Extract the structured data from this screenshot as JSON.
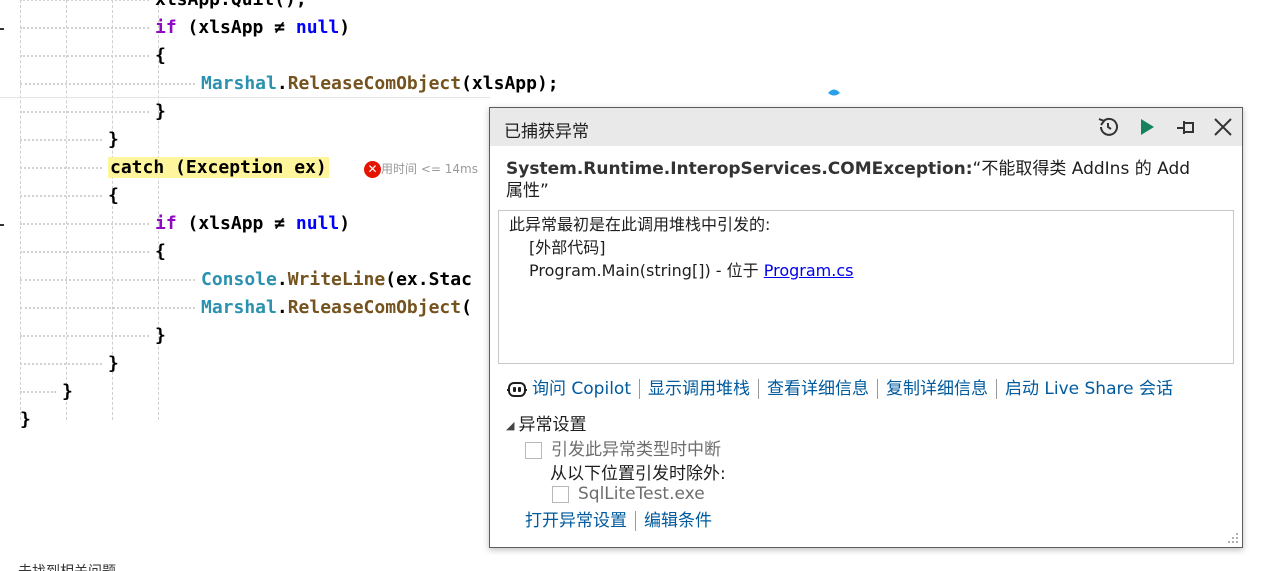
{
  "editor": {
    "lines": [
      {
        "segs": [
          {
            "t": "xlsApp.Quit();",
            "c": "plain"
          }
        ]
      },
      {
        "segs": [
          {
            "t": "if",
            "c": "kw"
          },
          {
            "t": " (xlsApp ≠ ",
            "c": "plain"
          },
          {
            "t": "null",
            "c": "kw2"
          },
          {
            "t": ")",
            "c": "plain"
          }
        ]
      },
      {
        "segs": [
          {
            "t": "{",
            "c": "plain"
          }
        ]
      },
      {
        "segs": [
          {
            "t": "Marshal",
            "c": "type"
          },
          {
            "t": ".",
            "c": "plain"
          },
          {
            "t": "ReleaseComObject",
            "c": "meth"
          },
          {
            "t": "(xlsApp);",
            "c": "plain"
          }
        ]
      },
      {
        "segs": [
          {
            "t": "}",
            "c": "plain"
          }
        ]
      },
      {
        "segs": [
          {
            "t": "}",
            "c": "plain"
          }
        ]
      },
      {
        "segs": [
          {
            "t": "catch (Exception ex)",
            "c": "plain catch-hl"
          }
        ]
      },
      {
        "segs": [
          {
            "t": "{",
            "c": "plain"
          }
        ]
      },
      {
        "segs": [
          {
            "t": "if",
            "c": "kw"
          },
          {
            "t": " (xlsApp ≠ ",
            "c": "plain"
          },
          {
            "t": "null",
            "c": "kw2"
          },
          {
            "t": ")",
            "c": "plain"
          }
        ]
      },
      {
        "segs": [
          {
            "t": "{",
            "c": "plain"
          }
        ]
      },
      {
        "segs": [
          {
            "t": "Console",
            "c": "type"
          },
          {
            "t": ".",
            "c": "plain"
          },
          {
            "t": "WriteLine",
            "c": "meth"
          },
          {
            "t": "(ex.Stac",
            "c": "plain"
          }
        ]
      },
      {
        "segs": [
          {
            "t": "Marshal",
            "c": "type"
          },
          {
            "t": ".",
            "c": "plain"
          },
          {
            "t": "ReleaseComObject",
            "c": "meth"
          },
          {
            "t": "(",
            "c": "plain"
          }
        ]
      },
      {
        "segs": [
          {
            "t": "}",
            "c": "plain"
          }
        ]
      },
      {
        "segs": [
          {
            "t": "}",
            "c": "plain"
          }
        ]
      },
      {
        "segs": [
          {
            "t": "}",
            "c": "plain"
          }
        ]
      },
      {
        "segs": [
          {
            "t": "}",
            "c": "plain"
          }
        ]
      }
    ],
    "perf_tip": "用时间 <= 14ms"
  },
  "popup": {
    "title": "已捕获异常",
    "exception_type": "System.Runtime.InteropServices.COMException:",
    "exception_message": "“不能取得类 AddIns 的 Add 属性”",
    "stack_intro": "此异常最初是在此调用堆栈中引发的:",
    "stack_frame_1": "[外部代码]",
    "stack_frame_2": "Program.Main(string[]) - 位于 ",
    "stack_frame_2_link": "Program.cs",
    "actions": {
      "copilot": "询问 Copilot",
      "call_stack": "显示调用堆栈",
      "details": "查看详细信息",
      "copy": "复制详细信息",
      "live_share": "启动 Live Share 会话"
    },
    "settings": {
      "header": "异常设置",
      "break_on_type": "引发此异常类型时中断",
      "except_when": "从以下位置引发时除外:",
      "module": "SqlLiteTest.exe",
      "open_settings": "打开异常设置",
      "edit_conditions": "编辑条件"
    }
  },
  "status": {
    "text": "未找到相关问题"
  },
  "colors": {
    "keyword": "#8f08c4",
    "null_keyword": "#0000ff",
    "type": "#2b91af",
    "method": "#74531f",
    "catch_highlight": "#fff59d",
    "link": "#005a9e",
    "error": "#e51400",
    "run_green": "#16825d"
  }
}
